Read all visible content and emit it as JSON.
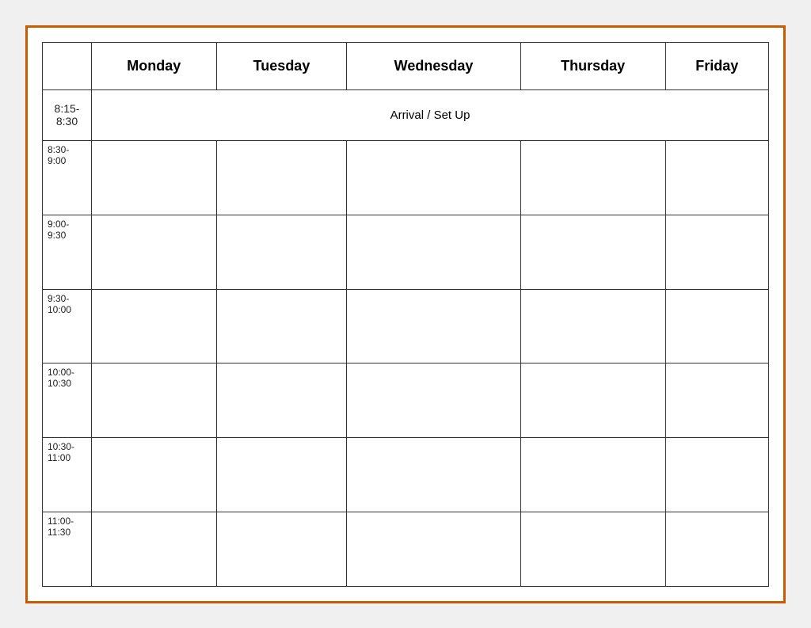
{
  "table": {
    "headers": {
      "time": "",
      "monday": "Monday",
      "tuesday": "Tuesday",
      "wednesday": "Wednesday",
      "thursday": "Thursday",
      "friday": "Friday"
    },
    "arrival_text": "Arrival / Set Up",
    "time_slots": [
      {
        "id": "slot-0",
        "label": "8:15-\n8:30"
      },
      {
        "id": "slot-1",
        "label": "8:30-\n9:00"
      },
      {
        "id": "slot-2",
        "label": "9:00-\n9:30"
      },
      {
        "id": "slot-3",
        "label": "9:30-\n10:00"
      },
      {
        "id": "slot-4",
        "label": "10:00-\n10:30"
      },
      {
        "id": "slot-5",
        "label": "10:30-\n11:00"
      },
      {
        "id": "slot-6",
        "label": "11:00-\n11:30"
      }
    ]
  }
}
